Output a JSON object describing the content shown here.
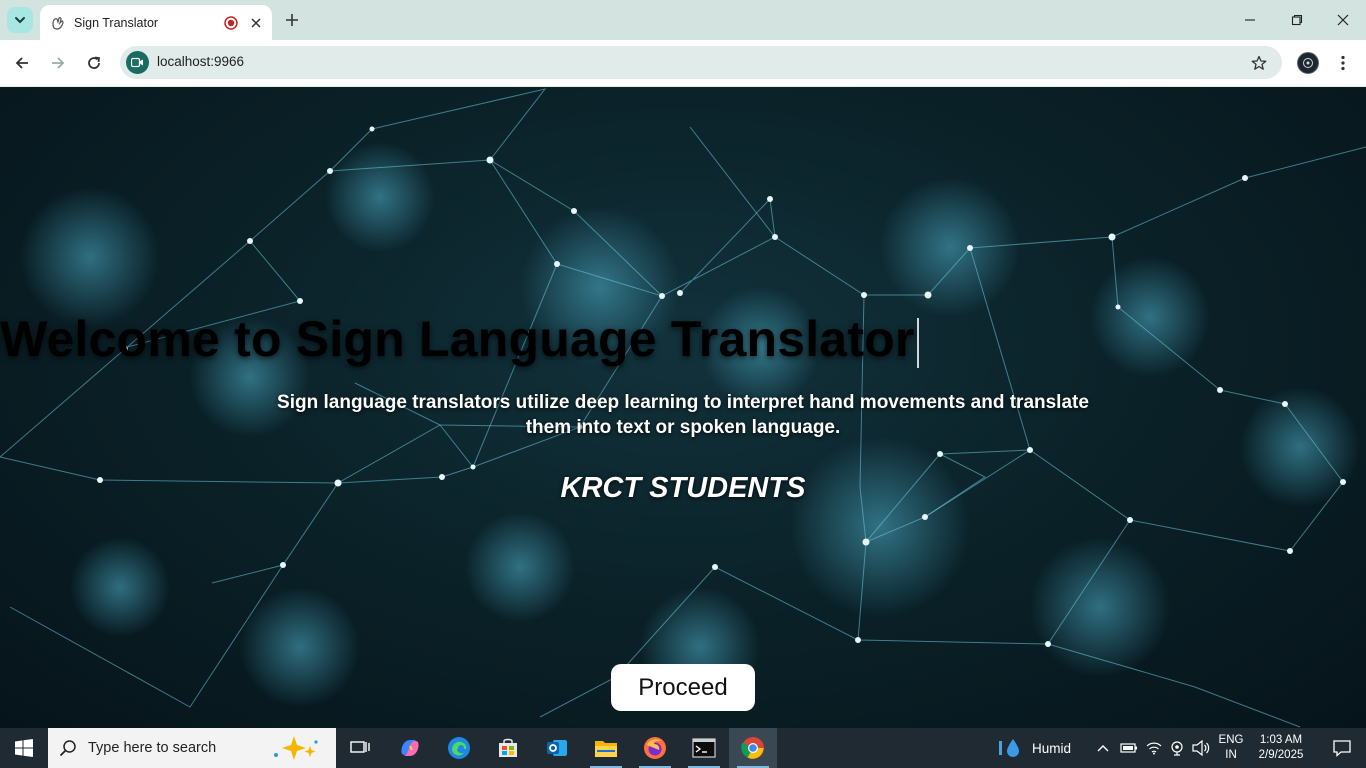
{
  "browser": {
    "tab_title": "Sign Translator",
    "url": "localhost:9966"
  },
  "page": {
    "title": "Welcome to Sign Language Translator",
    "subtitle": "Sign language translators utilize deep learning to interpret hand movements and translate them into text or spoken language.",
    "credit": "KRCT STUDENTS",
    "proceed_label": "Proceed"
  },
  "taskbar": {
    "search_placeholder": "Type here to search",
    "weather_label": "Humid",
    "lang_top": "ENG",
    "lang_bottom": "IN",
    "time": "1:03 AM",
    "date": "2/9/2025"
  },
  "colors": {
    "tabbar_bg": "#d3e3e0",
    "omnibox_bg": "#e1ecea",
    "site_badge": "#1a6b63",
    "page_bg": "#0b2229",
    "network_line": "#5fc4dc",
    "taskbar_bg": "#1f2a33"
  }
}
